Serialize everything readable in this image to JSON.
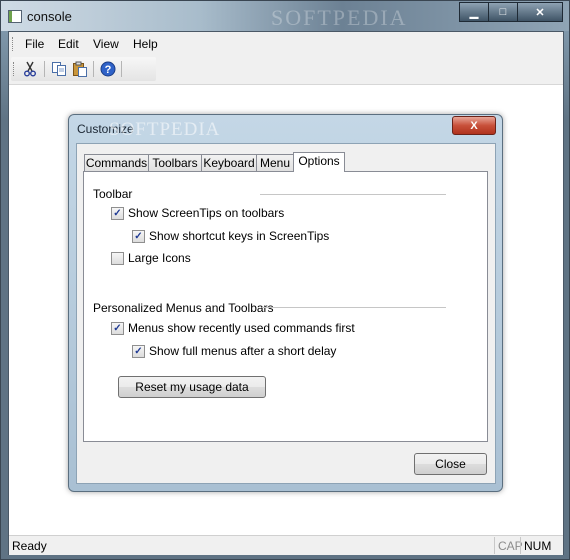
{
  "window": {
    "title": "console",
    "watermark": "SOFTPEDIA"
  },
  "menubar": {
    "items": [
      "File",
      "Edit",
      "View",
      "Help"
    ]
  },
  "toolbar": {
    "buttons": [
      "cut-icon",
      "copy-icon",
      "paste-icon",
      "help-icon"
    ]
  },
  "dialog": {
    "title": "Customize",
    "watermark": "SOFTPEDIA",
    "close_glyph": "X",
    "tabs": [
      "Commands",
      "Toolbars",
      "Keyboard",
      "Menu",
      "Options"
    ],
    "active_tab": "Options",
    "toolbar_group": {
      "label": "Toolbar",
      "options": [
        {
          "label": "Show ScreenTips on toolbars",
          "checked": true
        },
        {
          "label": "Show shortcut keys in ScreenTips",
          "checked": true
        },
        {
          "label": "Large Icons",
          "checked": false
        }
      ]
    },
    "menus_group": {
      "label": "Personalized Menus and Toolbars",
      "options": [
        {
          "label": "Menus show recently used commands first",
          "checked": true
        },
        {
          "label": "Show full menus after a short delay",
          "checked": true
        }
      ]
    },
    "reset_button": "Reset my usage data",
    "close_button": "Close"
  },
  "statusbar": {
    "text": "Ready",
    "cap": "CAP",
    "num": "NUM"
  }
}
